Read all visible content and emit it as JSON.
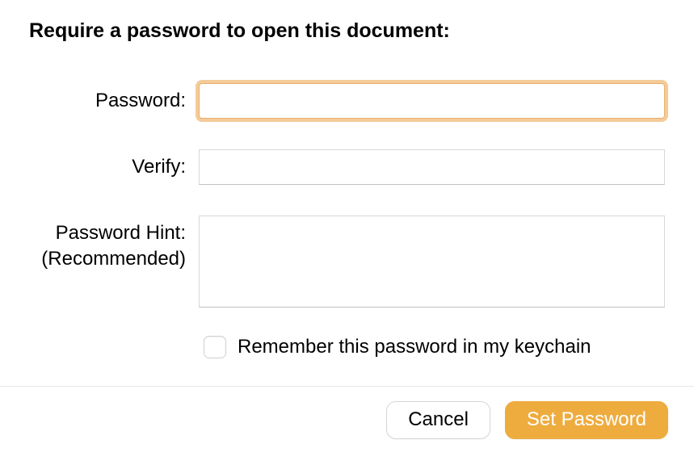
{
  "title": "Require a password to open this document:",
  "fields": {
    "password": {
      "label": "Password:",
      "value": ""
    },
    "verify": {
      "label": "Verify:",
      "value": ""
    },
    "hint": {
      "label_line1": "Password Hint:",
      "label_line2": "(Recommended)",
      "value": ""
    }
  },
  "checkbox": {
    "label": "Remember this password in my keychain",
    "checked": false
  },
  "buttons": {
    "cancel": "Cancel",
    "set_password": "Set Password"
  }
}
